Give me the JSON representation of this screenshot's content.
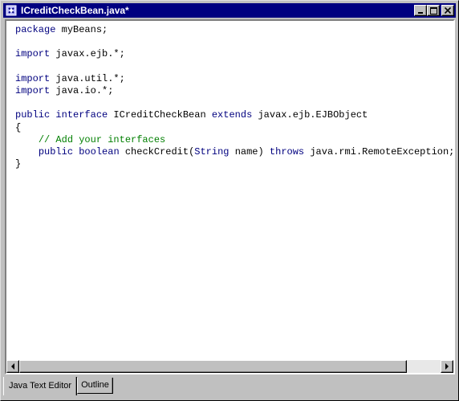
{
  "window": {
    "title": "ICreditCheckBean.java*",
    "controls": [
      "minimize-icon",
      "maximize-icon",
      "close-icon"
    ]
  },
  "editor": {
    "lines": [
      [
        {
          "t": "package",
          "k": "kw"
        },
        {
          "t": " myBeans;"
        }
      ],
      [],
      [
        {
          "t": "import",
          "k": "kw"
        },
        {
          "t": " javax.ejb.*;"
        }
      ],
      [],
      [
        {
          "t": "import",
          "k": "kw"
        },
        {
          "t": " java.util.*;"
        }
      ],
      [
        {
          "t": "import",
          "k": "kw"
        },
        {
          "t": " java.io.*;"
        }
      ],
      [],
      [
        {
          "t": "public",
          "k": "kw"
        },
        {
          "t": " "
        },
        {
          "t": "interface",
          "k": "kw"
        },
        {
          "t": " ICreditCheckBean "
        },
        {
          "t": "extends",
          "k": "kw"
        },
        {
          "t": " javax.ejb.EJBObject"
        }
      ],
      [
        {
          "t": "{"
        }
      ],
      [
        {
          "t": "    "
        },
        {
          "t": "// Add your interfaces",
          "k": "cm"
        }
      ],
      [
        {
          "t": "    "
        },
        {
          "t": "public",
          "k": "kw"
        },
        {
          "t": " "
        },
        {
          "t": "boolean",
          "k": "kw"
        },
        {
          "t": " checkCredit("
        },
        {
          "t": "String",
          "k": "kw"
        },
        {
          "t": " name) "
        },
        {
          "t": "throws",
          "k": "kw"
        },
        {
          "t": " java.rmi.RemoteException;"
        }
      ],
      [
        {
          "t": "}"
        }
      ]
    ],
    "colors": {
      "keyword": "#00007f",
      "comment": "#007f00",
      "text": "#000000",
      "titlebar": "#000080"
    }
  },
  "scrollbar": {
    "horizontal_position": 0.0,
    "visible_fraction": 0.92
  },
  "tabs": [
    {
      "label": "Java Text Editor",
      "active": true
    },
    {
      "label": "Outline",
      "active": false
    }
  ]
}
